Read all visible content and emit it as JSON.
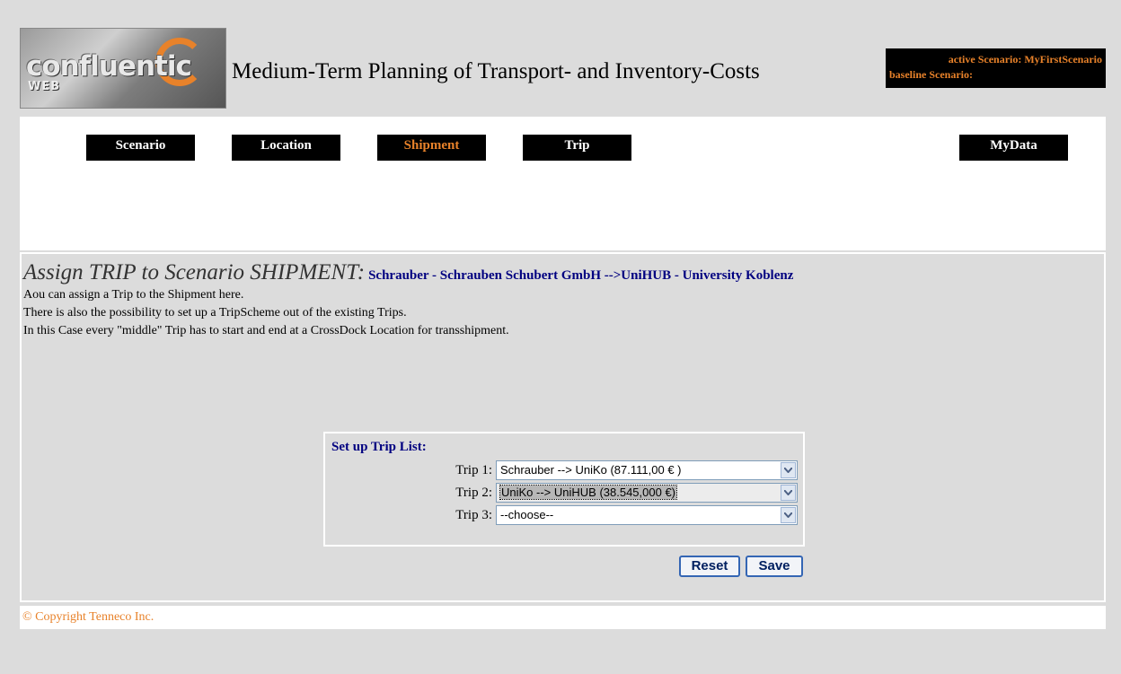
{
  "header": {
    "logo_text": "confluentic",
    "logo_sub": "WEB",
    "app_title": "Medium-Term Planning of Transport- and Inventory-Costs",
    "active_scenario": "active Scenario: MyFirstScenario",
    "baseline_scenario": "baseline Scenario:"
  },
  "nav": {
    "items": [
      {
        "label": "Scenario"
      },
      {
        "label": "Location"
      },
      {
        "label": "Shipment"
      },
      {
        "label": "Trip"
      },
      {
        "label": "MyData"
      }
    ],
    "active_item": "Shipment"
  },
  "main": {
    "heading": "Assign TRIP to Scenario SHIPMENT:",
    "subheading": "Schrauber - Schrauben Schubert GmbH -->UniHUB - University Koblenz",
    "description_lines": [
      "Aou can assign a Trip to the Shipment here.",
      "There is also the possibility to set up a TripScheme out of the existing Trips.",
      "In this Case every \"middle\" Trip has to start and end at a CrossDock Location for transshipment."
    ],
    "trip_list": {
      "title": "Set up Trip List:",
      "trips": [
        {
          "label": "Trip 1:",
          "value": "Schrauber --> UniKo (87.111,00 € )"
        },
        {
          "label": "Trip 2:",
          "value": "UniKo --> UniHUB (38.545,000 €)"
        },
        {
          "label": "Trip 3:",
          "value": "--choose--"
        }
      ]
    },
    "buttons": {
      "reset": "Reset",
      "save": "Save"
    }
  },
  "footer": {
    "copyright": "© Copyright Tenneco Inc."
  },
  "colors": {
    "accent_orange": "#e8822a",
    "link_navy": "#000080",
    "nav_bg": "#000000",
    "page_bg": "#dcdcdc"
  }
}
